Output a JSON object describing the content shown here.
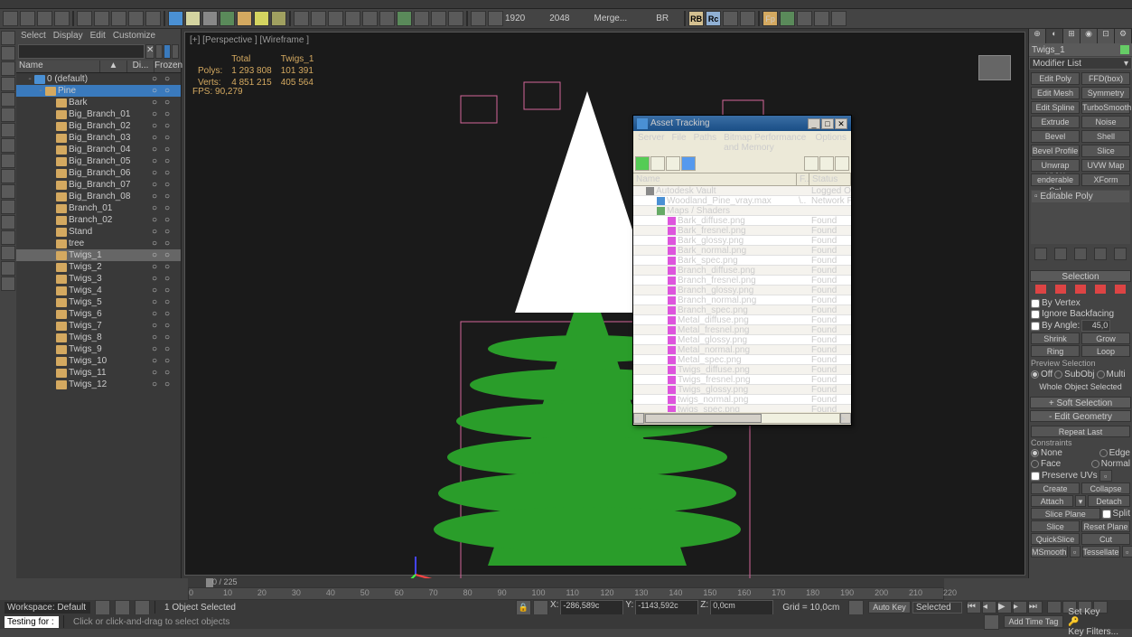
{
  "topmenu": [],
  "toolbar2_nums": [
    "1920",
    "2048"
  ],
  "toolbar2_txt": [
    "Merge...",
    "BR"
  ],
  "toolbar2_btns": [
    "RB",
    "Rc"
  ],
  "lp_menu": [
    "Select",
    "Display",
    "Edit",
    "Customize"
  ],
  "lp_head": [
    "Name",
    "▲",
    "Di...",
    "Frozen"
  ],
  "tree": [
    {
      "ind": 0,
      "ex": "-",
      "ic": "geo",
      "nm": "0 (default)"
    },
    {
      "ind": 1,
      "ex": "-",
      "ic": "",
      "nm": "Pine",
      "sel": true
    },
    {
      "ind": 2,
      "ex": "",
      "ic": "",
      "nm": "Bark"
    },
    {
      "ind": 2,
      "ex": "",
      "ic": "",
      "nm": "Big_Branch_01"
    },
    {
      "ind": 2,
      "ex": "",
      "ic": "",
      "nm": "Big_Branch_02"
    },
    {
      "ind": 2,
      "ex": "",
      "ic": "",
      "nm": "Big_Branch_03"
    },
    {
      "ind": 2,
      "ex": "",
      "ic": "",
      "nm": "Big_Branch_04"
    },
    {
      "ind": 2,
      "ex": "",
      "ic": "",
      "nm": "Big_Branch_05"
    },
    {
      "ind": 2,
      "ex": "",
      "ic": "",
      "nm": "Big_Branch_06"
    },
    {
      "ind": 2,
      "ex": "",
      "ic": "",
      "nm": "Big_Branch_07"
    },
    {
      "ind": 2,
      "ex": "",
      "ic": "",
      "nm": "Big_Branch_08"
    },
    {
      "ind": 2,
      "ex": "",
      "ic": "",
      "nm": "Branch_01"
    },
    {
      "ind": 2,
      "ex": "",
      "ic": "",
      "nm": "Branch_02"
    },
    {
      "ind": 2,
      "ex": "",
      "ic": "",
      "nm": "Stand"
    },
    {
      "ind": 2,
      "ex": "",
      "ic": "",
      "nm": "tree"
    },
    {
      "ind": 2,
      "ex": "",
      "ic": "",
      "nm": "Twigs_1",
      "hsel": true
    },
    {
      "ind": 2,
      "ex": "",
      "ic": "",
      "nm": "Twigs_2"
    },
    {
      "ind": 2,
      "ex": "",
      "ic": "",
      "nm": "Twigs_3"
    },
    {
      "ind": 2,
      "ex": "",
      "ic": "",
      "nm": "Twigs_4"
    },
    {
      "ind": 2,
      "ex": "",
      "ic": "",
      "nm": "Twigs_5"
    },
    {
      "ind": 2,
      "ex": "",
      "ic": "",
      "nm": "Twigs_6"
    },
    {
      "ind": 2,
      "ex": "",
      "ic": "",
      "nm": "Twigs_7"
    },
    {
      "ind": 2,
      "ex": "",
      "ic": "",
      "nm": "Twigs_8"
    },
    {
      "ind": 2,
      "ex": "",
      "ic": "",
      "nm": "Twigs_9"
    },
    {
      "ind": 2,
      "ex": "",
      "ic": "",
      "nm": "Twigs_10"
    },
    {
      "ind": 2,
      "ex": "",
      "ic": "",
      "nm": "Twigs_11"
    },
    {
      "ind": 2,
      "ex": "",
      "ic": "",
      "nm": "Twigs_12"
    }
  ],
  "vp_label": "[+] [Perspective ] [Wireframe ]",
  "stats": {
    "h": [
      "",
      "Total",
      "Twigs_1"
    ],
    "r1": [
      "Polys:",
      "1 293 808",
      "101 391"
    ],
    "r2": [
      "Verts:",
      "4 851 215",
      "405 564"
    ],
    "fps": "FPS:      90,279"
  },
  "rp": {
    "name": "Twigs_1",
    "modlist": "Modifier List",
    "btns": [
      "Edit Poly",
      "FFD(box)",
      "Edit Mesh",
      "Symmetry",
      "Edit Spline",
      "TurboSmooth",
      "Extrude",
      "Noise",
      "Bevel",
      "Shell",
      "Bevel Profile",
      "Slice",
      "Unwrap UVW",
      "UVW Map",
      "enderable Spl",
      "XForm"
    ],
    "stack": "Editable Poly",
    "roll_sel": "Selection",
    "by_vertex": "By Vertex",
    "ignore_bf": "Ignore Backfacing",
    "by_angle": "By Angle:",
    "angle_val": "45,0",
    "shrink": "Shrink",
    "grow": "Grow",
    "ring": "Ring",
    "loop": "Loop",
    "prev_sel": "Preview Selection",
    "off": "Off",
    "subobj": "SubObj",
    "multi": "Multi",
    "whole": "Whole Object Selected",
    "soft": "Soft Selection",
    "editgeo": "Edit Geometry",
    "repeat": "Repeat Last",
    "constraints": "Constraints",
    "none": "None",
    "edge": "Edge",
    "face": "Face",
    "normal": "Normal",
    "presuv": "Preserve UVs",
    "create": "Create",
    "collapse": "Collapse",
    "attach": "Attach",
    "detach": "Detach",
    "sliceplane": "Slice Plane",
    "split": "Split",
    "slice": "Slice",
    "resetplane": "Reset Plane",
    "quickslice": "QuickSlice",
    "cut": "Cut",
    "msmooth": "MSmooth",
    "tessellate": "Tessellate"
  },
  "asset": {
    "title": "Asset Tracking",
    "menu": [
      "Server",
      "File",
      "Paths",
      "Bitmap Performance and Memory",
      "Options"
    ],
    "head": [
      "Name",
      "F..",
      "Status"
    ],
    "rows": [
      {
        "ind": 1,
        "ic": "vault",
        "nm": "Autodesk Vault",
        "st": "Logged Out"
      },
      {
        "ind": 2,
        "ic": "max",
        "nm": "Woodland_Pine_vray.max",
        "f": "\\..",
        "st": "Network Path"
      },
      {
        "ind": 2,
        "ic": "map",
        "nm": "Maps / Shaders",
        "st": ""
      },
      {
        "ind": 3,
        "ic": "img",
        "nm": "Bark_diffuse.png",
        "st": "Found"
      },
      {
        "ind": 3,
        "ic": "img",
        "nm": "Bark_fresnel.png",
        "st": "Found"
      },
      {
        "ind": 3,
        "ic": "img",
        "nm": "Bark_glossy.png",
        "st": "Found"
      },
      {
        "ind": 3,
        "ic": "img",
        "nm": "Bark_normal.png",
        "st": "Found"
      },
      {
        "ind": 3,
        "ic": "img",
        "nm": "Bark_spec.png",
        "st": "Found"
      },
      {
        "ind": 3,
        "ic": "img",
        "nm": "Branch_diffuse.png",
        "st": "Found"
      },
      {
        "ind": 3,
        "ic": "img",
        "nm": "Branch_fresnel.png",
        "st": "Found"
      },
      {
        "ind": 3,
        "ic": "img",
        "nm": "Branch_glossy.png",
        "st": "Found"
      },
      {
        "ind": 3,
        "ic": "img",
        "nm": "Branch_normal.png",
        "st": "Found"
      },
      {
        "ind": 3,
        "ic": "img",
        "nm": "Branch_spec.png",
        "st": "Found"
      },
      {
        "ind": 3,
        "ic": "img",
        "nm": "Metal_diffuse.png",
        "st": "Found"
      },
      {
        "ind": 3,
        "ic": "img",
        "nm": "Metal_fresnel.png",
        "st": "Found"
      },
      {
        "ind": 3,
        "ic": "img",
        "nm": "Metal_glossy.png",
        "st": "Found"
      },
      {
        "ind": 3,
        "ic": "img",
        "nm": "Metal_normal.png",
        "st": "Found"
      },
      {
        "ind": 3,
        "ic": "img",
        "nm": "Metal_spec.png",
        "st": "Found"
      },
      {
        "ind": 3,
        "ic": "img",
        "nm": "Twigs_diffuse.png",
        "st": "Found"
      },
      {
        "ind": 3,
        "ic": "img",
        "nm": "Twigs_fresnel.png",
        "st": "Found"
      },
      {
        "ind": 3,
        "ic": "img",
        "nm": "Twigs_glossy.png",
        "st": "Found"
      },
      {
        "ind": 3,
        "ic": "img",
        "nm": "twigs_normal.png",
        "st": "Found"
      },
      {
        "ind": 3,
        "ic": "img",
        "nm": "twigs_spec.png",
        "st": "Found"
      }
    ]
  },
  "time_lbl": "0 / 225",
  "ruler": [
    "0",
    "10",
    "20",
    "30",
    "40",
    "50",
    "60",
    "70",
    "80",
    "90",
    "100",
    "110",
    "120",
    "130",
    "140",
    "150",
    "160",
    "170",
    "180",
    "190",
    "200",
    "210",
    "220"
  ],
  "status": {
    "ws_lbl": "Workspace: Default",
    "sel": "1 Object Selected",
    "msg": "Click or click-and-drag to select objects",
    "tf": "Testing for :",
    "x": "X:",
    "xv": "-286,589c",
    "y": "Y:",
    "yv": "-1143,592c",
    "z": "Z:",
    "zv": "0,0cm",
    "grid": "Grid = 10,0cm",
    "autokey": "Auto Key",
    "setkey": "Set Key",
    "sel2": "Selected",
    "keyf": "Key Filters...",
    "tag": "Add Time Tag"
  }
}
